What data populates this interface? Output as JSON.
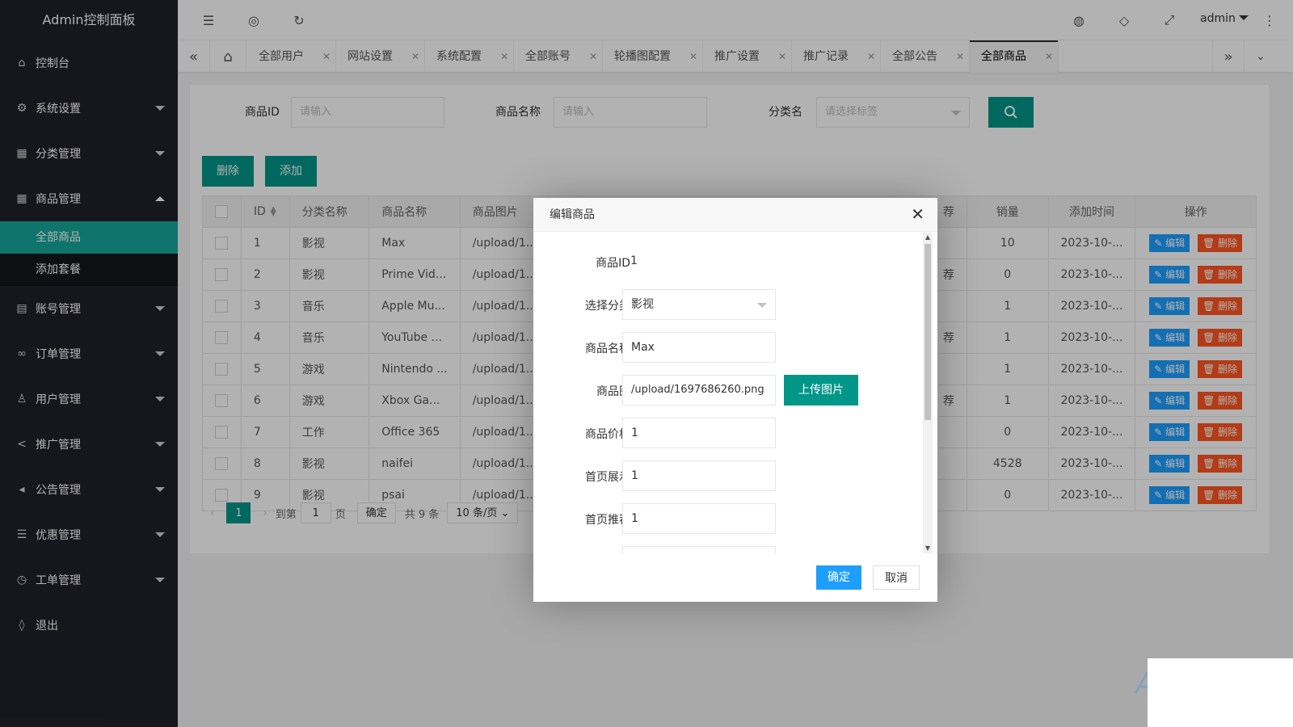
{
  "sidebar": {
    "brand": "Admin控制面板",
    "items": [
      {
        "label": "控制台",
        "icon": "home-icon"
      },
      {
        "label": "系统设置",
        "icon": "gear-icon"
      },
      {
        "label": "分类管理",
        "icon": "apps-icon"
      },
      {
        "label": "商品管理",
        "icon": "apps-icon"
      },
      {
        "label": "账号管理",
        "icon": "table-icon"
      },
      {
        "label": "订单管理",
        "icon": "link-icon"
      },
      {
        "label": "用户管理",
        "icon": "user-icon"
      },
      {
        "label": "推广管理",
        "icon": "share-icon"
      },
      {
        "label": "公告管理",
        "icon": "speaker-icon"
      },
      {
        "label": "优惠管理",
        "icon": "list-icon"
      },
      {
        "label": "工单管理",
        "icon": "clock-icon"
      },
      {
        "label": "退出",
        "icon": "shield-icon"
      }
    ],
    "sub_items": [
      "全部商品",
      "添加套餐"
    ]
  },
  "header": {
    "user": "admin"
  },
  "tabs": [
    "全部用户",
    "网站设置",
    "系统配置",
    "全部账号",
    "轮播图配置",
    "推广设置",
    "推广记录",
    "全部公告",
    "全部商品"
  ],
  "search": {
    "id_label": "商品ID",
    "id_placeholder": "请输入",
    "name_label": "商品名称",
    "name_placeholder": "请输入",
    "cat_label": "分类名",
    "cat_placeholder": "请选择标签"
  },
  "actions": {
    "delete": "删除",
    "add": "添加"
  },
  "table": {
    "headers": {
      "id": "ID",
      "category": "分类名称",
      "name": "商品名称",
      "image": "商品图片",
      "rec": "荐",
      "sales": "销量",
      "added": "添加时间",
      "ops": "操作"
    },
    "edit_label": "编辑",
    "delete_label": "删除",
    "rows": [
      {
        "id": "1",
        "category": "影视",
        "name": "Max",
        "image": "/upload/1...",
        "rec": "",
        "sales": "10",
        "added": "2023-10-..."
      },
      {
        "id": "2",
        "category": "影视",
        "name": "Prime Vid...",
        "image": "/upload/1...",
        "rec": "荐",
        "sales": "0",
        "added": "2023-10-..."
      },
      {
        "id": "3",
        "category": "音乐",
        "name": "Apple Mu...",
        "image": "/upload/1...",
        "rec": "",
        "sales": "1",
        "added": "2023-10-..."
      },
      {
        "id": "4",
        "category": "音乐",
        "name": "YouTube ...",
        "image": "/upload/1...",
        "rec": "荐",
        "sales": "1",
        "added": "2023-10-..."
      },
      {
        "id": "5",
        "category": "游戏",
        "name": "Nintendo ...",
        "image": "/upload/1...",
        "rec": "",
        "sales": "1",
        "added": "2023-10-..."
      },
      {
        "id": "6",
        "category": "游戏",
        "name": "Xbox Ga...",
        "image": "/upload/1...",
        "rec": "荐",
        "sales": "1",
        "added": "2023-10-..."
      },
      {
        "id": "7",
        "category": "工作",
        "name": "Office 365",
        "image": "/upload/1...",
        "rec": "",
        "sales": "0",
        "added": "2023-10-..."
      },
      {
        "id": "8",
        "category": "影视",
        "name": "naifei",
        "image": "/upload/1...",
        "rec": "",
        "sales": "4528",
        "added": "2023-10-..."
      },
      {
        "id": "9",
        "category": "影视",
        "name": "psai",
        "image": "/upload/1...",
        "rec": "",
        "sales": "0",
        "added": "2023-10-..."
      }
    ]
  },
  "pager": {
    "current": "1",
    "goto_label": "到第",
    "goto_value": "1",
    "page_unit": "页",
    "confirm": "确定",
    "total": "共 9 条",
    "per_page": "10 条/页"
  },
  "modal": {
    "title": "编辑商品",
    "fields": {
      "id_label": "商品ID",
      "id_value": "1",
      "cat_label": "选择分类",
      "cat_value": "影视",
      "name_label": "商品名称",
      "name_value": "Max",
      "img_label": "商品图",
      "img_value": "/upload/1697686260.png",
      "upload_label": "上传图片",
      "price_label": "商品价格",
      "price_value": "1",
      "home_show_label": "首页展示",
      "home_show_value": "1",
      "home_rec_label": "首页推荐",
      "home_rec_value": "1"
    },
    "ok": "确定",
    "cancel": "取消"
  },
  "colors": {
    "sidebar_bg": "#20222a",
    "accent": "#009688",
    "edit": "#1e9fff",
    "delete": "#ff5722"
  }
}
